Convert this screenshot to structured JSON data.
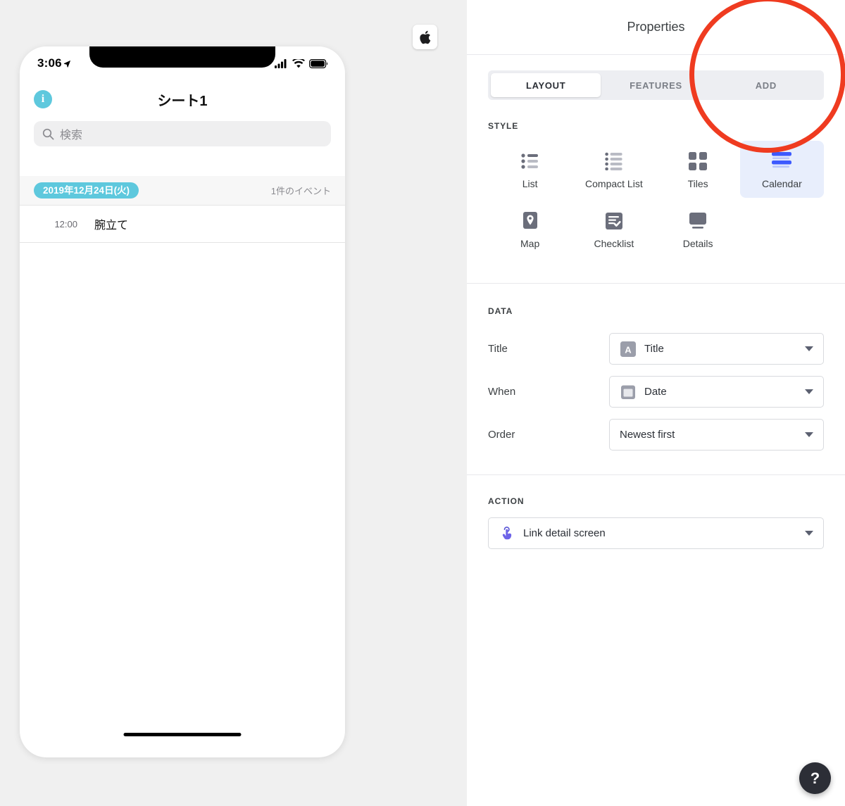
{
  "preview": {
    "apple_badge_icon": "apple-logo-icon",
    "phone": {
      "status": {
        "time": "3:06",
        "location_arrow_icon": "location-arrow-icon",
        "signal_icon": "cellular-signal-icon",
        "wifi_icon": "wifi-icon",
        "battery_icon": "battery-icon"
      },
      "nav": {
        "info_icon": "info-circle-icon",
        "title": "シート1"
      },
      "search": {
        "icon": "search-icon",
        "placeholder": "検索"
      },
      "date_header": {
        "chip": "2019年12月24日(火)",
        "count": "1件のイベント"
      },
      "events": [
        {
          "time": "12:00",
          "title": "腕立て"
        }
      ]
    }
  },
  "panel": {
    "title": "Properties",
    "tabs": [
      {
        "label": "LAYOUT",
        "active": true
      },
      {
        "label": "FEATURES",
        "active": false
      },
      {
        "label": "ADD",
        "active": false,
        "annotated": true
      }
    ],
    "style": {
      "label": "STYLE",
      "options": [
        {
          "label": "List",
          "icon": "list-icon",
          "selected": false
        },
        {
          "label": "Compact List",
          "icon": "compact-list-icon",
          "selected": false
        },
        {
          "label": "Tiles",
          "icon": "tiles-icon",
          "selected": false
        },
        {
          "label": "Calendar",
          "icon": "calendar-icon",
          "selected": true
        },
        {
          "label": "Map",
          "icon": "map-pin-icon",
          "selected": false
        },
        {
          "label": "Checklist",
          "icon": "checklist-icon",
          "selected": false
        },
        {
          "label": "Details",
          "icon": "details-icon",
          "selected": false
        }
      ]
    },
    "data": {
      "label": "DATA",
      "fields": [
        {
          "label": "Title",
          "value": "Title",
          "icon": "text-field-icon"
        },
        {
          "label": "When",
          "value": "Date",
          "icon": "date-field-icon"
        },
        {
          "label": "Order",
          "value": "Newest first",
          "icon": null
        }
      ]
    },
    "action": {
      "label": "ACTION",
      "value": "Link detail screen",
      "icon": "tap-finger-icon"
    },
    "help_button": {
      "label": "?",
      "icon": "help-icon"
    }
  },
  "colors": {
    "accent_cyan": "#5ec8dd",
    "selected_blue": "#3d5afe",
    "selected_bg": "#e8eefc",
    "annotation_red": "#ef3b20",
    "icon_gray": "#6b6e7b",
    "canvas_bg": "#f0f0f0"
  }
}
